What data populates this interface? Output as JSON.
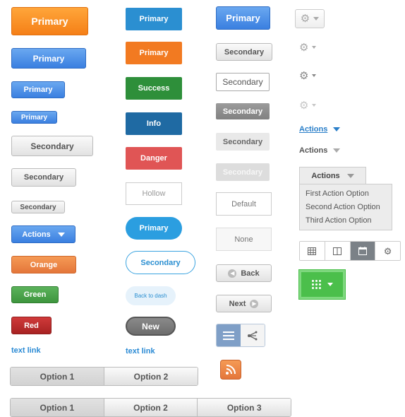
{
  "col1": {
    "primary_orange": "Primary",
    "primary_large": "Primary",
    "primary_medium": "Primary",
    "primary_small": "Primary",
    "secondary_large": "Secondary",
    "secondary_medium": "Secondary",
    "secondary_small": "Secondary",
    "actions": "Actions",
    "orange": "Orange",
    "green": "Green",
    "red": "Red",
    "text_link": "text link"
  },
  "col2": {
    "primary": "Primary",
    "primary_orange": "Primary",
    "success": "Success",
    "info": "Info",
    "danger": "Danger",
    "hollow": "Hollow",
    "pill_primary": "Primary",
    "pill_secondary": "Secondary",
    "back_to_dash": "Back to dash",
    "new": "New",
    "text_link": "text link"
  },
  "col3": {
    "primary": "Primary",
    "secondary_1": "Secondary",
    "secondary_2": "Secondary",
    "secondary_dark": "Secondary",
    "secondary_light": "Secondary",
    "secondary_disabled": "Secondary",
    "default": "Default",
    "none": "None",
    "back": "Back",
    "next": "Next"
  },
  "col4": {
    "actions_link": "Actions",
    "actions_plain": "Actions",
    "dropdown_header": "Actions",
    "options": [
      "First Action Option",
      "Second Action Option",
      "Third Action Option"
    ]
  },
  "segmented_2": [
    "Option 1",
    "Option 2"
  ],
  "segmented_3": [
    "Option 1",
    "Option 2",
    "Option 3"
  ],
  "icons": {
    "gear": "gear-icon",
    "caret": "caret-down-icon",
    "back": "back-arrow-icon",
    "next": "next-arrow-icon",
    "list": "list-icon",
    "share": "share-icon",
    "rss": "rss-icon",
    "grid": "grid-icon",
    "columns": "columns-icon",
    "calendar": "calendar-icon",
    "settings": "settings-icon",
    "dots": "dots-grid-icon"
  },
  "colors": {
    "blue": "#2b8fd1",
    "orange": "#f27a21",
    "success": "#2e8f3a",
    "info": "#1f6aa3",
    "danger": "#e05555",
    "green_bright": "#57c957"
  }
}
